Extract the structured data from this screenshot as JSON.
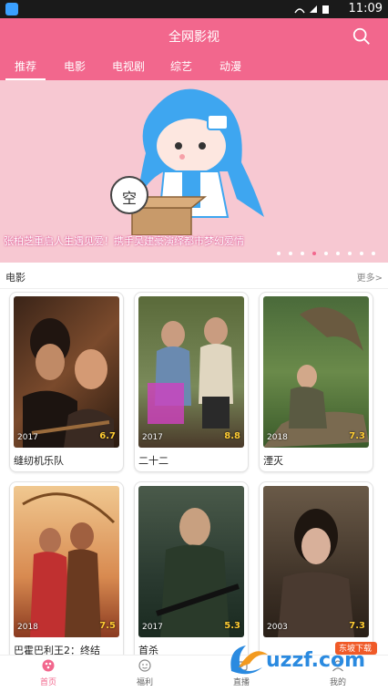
{
  "status_bar": {
    "time": "11:09"
  },
  "header": {
    "title": "全网影视"
  },
  "tabs": [
    "推荐",
    "电影",
    "电视剧",
    "综艺",
    "动漫"
  ],
  "banner": {
    "caption": "张柏芝重启人生遇见爱！携手吴建豪演绎都市梦幻爱情",
    "placeholder_char": "空",
    "active_dot": 3,
    "dot_count": 9
  },
  "section": {
    "title": "电影",
    "more": "更多>"
  },
  "movies": [
    {
      "title": "缝纫机乐队",
      "year": "2017",
      "score": "6.7"
    },
    {
      "title": "二十二",
      "year": "2017",
      "score": "8.8"
    },
    {
      "title": "湮灭",
      "year": "2018",
      "score": "7.3"
    },
    {
      "title": "巴霍巴利王2：终结",
      "year": "2018",
      "score": "7.5"
    },
    {
      "title": "首杀",
      "year": "2017",
      "score": "5.3"
    },
    {
      "title": "",
      "year": "2003",
      "score": "7.3"
    }
  ],
  "bottom_nav": [
    {
      "label": "首页",
      "icon": "home-icon"
    },
    {
      "label": "福利",
      "icon": "gift-icon"
    },
    {
      "label": "直播",
      "icon": "live-icon"
    },
    {
      "label": "我的",
      "icon": "user-icon"
    }
  ],
  "watermark": {
    "text": "uzzf.com",
    "badge": "东坡下载"
  },
  "colors": {
    "accent": "#f2678d"
  }
}
